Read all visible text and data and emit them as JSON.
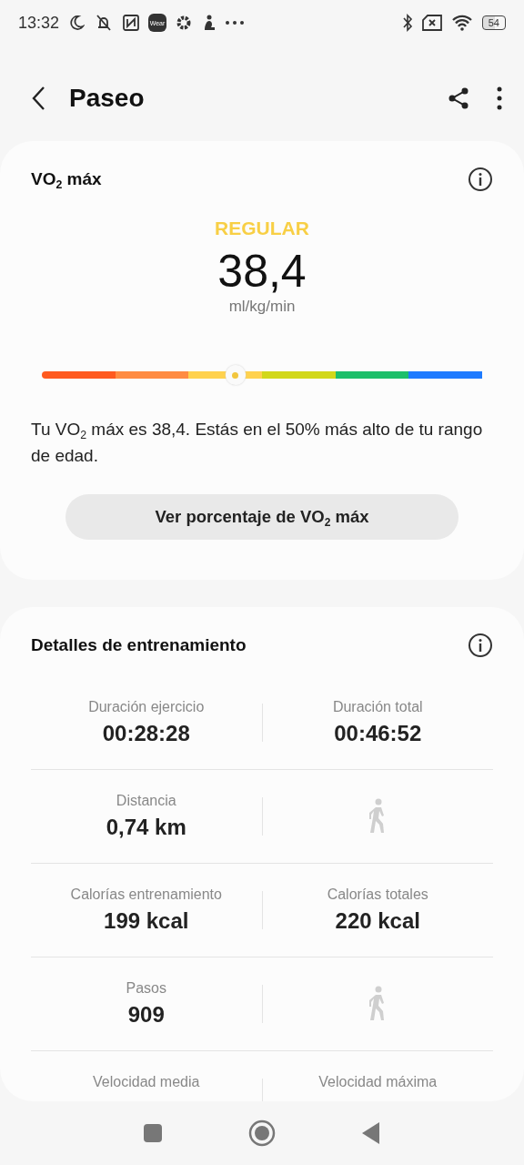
{
  "status_bar": {
    "time": "13:32",
    "wear_label": "Wear",
    "battery": "54"
  },
  "header": {
    "title": "Paseo"
  },
  "vo2_card": {
    "title": "VO$_{2}$ máx",
    "rating": "REGULAR",
    "value": "38,4",
    "unit": "ml/kg/min",
    "scale": {
      "level": 0.44,
      "segments": [
        {
          "color": "#ff5a1f"
        },
        {
          "color": "#ff8c42"
        },
        {
          "color": "#ffd24d"
        },
        {
          "color": "#d2d81a"
        },
        {
          "color": "#1dbf6a"
        },
        {
          "color": "#1e7bff"
        }
      ]
    },
    "description": "Tu VO$_{2}$ máx es 38,4. Estás en el 50% más alto de tu rango de edad.",
    "button": "Ver porcentaje de VO$_{2}$ máx"
  },
  "details_card": {
    "title": "Detalles de entrenamiento",
    "rows": [
      [
        {
          "kind": "metric",
          "label": "Duración ejercicio",
          "value": "00:28:28"
        },
        {
          "kind": "metric",
          "label": "Duración total",
          "value": "00:46:52"
        }
      ],
      [
        {
          "kind": "metric",
          "label": "Distancia",
          "value": "0,74 km"
        },
        {
          "kind": "icon"
        }
      ],
      [
        {
          "kind": "metric",
          "label": "Calorías entrenamiento",
          "value": "199 kcal"
        },
        {
          "kind": "metric",
          "label": "Calorías totales",
          "value": "220 kcal"
        }
      ],
      [
        {
          "kind": "metric",
          "label": "Pasos",
          "value": "909"
        },
        {
          "kind": "icon"
        }
      ],
      [
        {
          "kind": "metric",
          "label": "Velocidad media"
        },
        {
          "kind": "metric",
          "label": "Velocidad máxima"
        }
      ]
    ]
  }
}
